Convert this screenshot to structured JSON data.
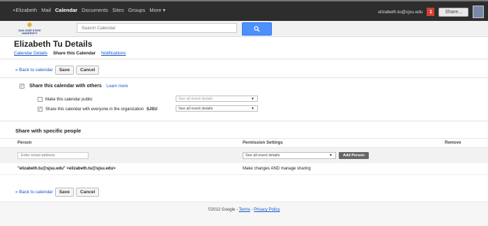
{
  "topbar": {
    "nav": [
      "+Elizabeth",
      "Mail",
      "Calendar",
      "Documents",
      "Sites",
      "Groups",
      "More ▾"
    ],
    "active_index": 2,
    "email": "elizabeth.tu@sjsu.edu",
    "notif_count": "1",
    "share_label": "Share..."
  },
  "logo": {
    "text1": "SAN JOSÉ STATE",
    "text2": "UNIVERSITY"
  },
  "search": {
    "placeholder": "Search Calendar",
    "button_icon": "search-icon"
  },
  "page": {
    "title": "Elizabeth Tu Details",
    "tabs": [
      "Calendar Details",
      "Share this Calendar",
      "Notifications"
    ],
    "active_tab": 1
  },
  "actions": {
    "back": "« Back to calendar",
    "save": "Save",
    "cancel": "Cancel"
  },
  "share": {
    "heading": "Share this calendar with others",
    "learn_more": "Learn more",
    "public_label": "Make this calendar public",
    "public_select": "See all event details",
    "org_label_prefix": "Share this calendar with everyone in the organization",
    "org_name": "SJSU",
    "org_select": "See all event details"
  },
  "specific": {
    "title": "Share with specific people",
    "columns": {
      "person": "Person",
      "permission": "Permission Settings",
      "remove": "Remove"
    },
    "email_placeholder": "Enter email address",
    "permission_select": "See all event details",
    "add_person": "Add Person",
    "rows": [
      {
        "person": "\"elizabeth.tu@sjsu.edu\" <elizabeth.tu@sjsu.edu>",
        "permission": "Make changes AND manage sharing"
      }
    ]
  },
  "footer": {
    "copyright": "©2012 Google - ",
    "terms": "Terms",
    "sep": " - ",
    "privacy": "Privacy Policy"
  },
  "colors": {
    "topbar": "#2d2d2d",
    "accent_blue": "#4d90fe",
    "link": "#1155cc",
    "notif_red": "#d23f31"
  }
}
